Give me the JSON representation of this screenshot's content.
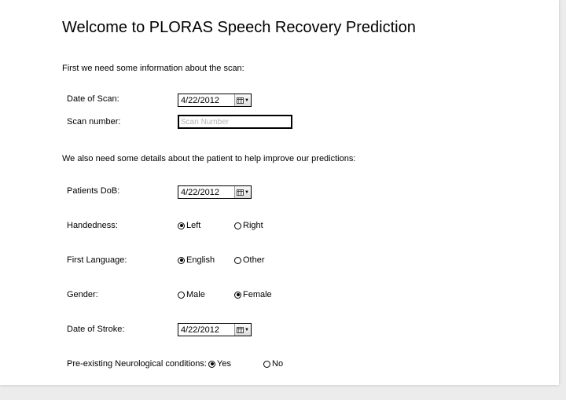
{
  "title": "Welcome to PLORAS Speech Recovery Prediction",
  "scan_section": {
    "intro": "First we need some information about the scan:",
    "date_label": "Date of Scan:",
    "date_value": "4/22/2012",
    "number_label": "Scan number:",
    "number_placeholder": "Scan Number",
    "number_value": ""
  },
  "patient_section": {
    "intro": "We also need some details about the patient to help improve our predictions:",
    "dob_label": "Patients DoB:",
    "dob_value": "4/22/2012",
    "handedness_label": "Handedness:",
    "handedness_options": [
      "Left",
      "Right"
    ],
    "handedness_selected": "Left",
    "language_label": "First Language:",
    "language_options": [
      "English",
      "Other"
    ],
    "language_selected": "English",
    "gender_label": "Gender:",
    "gender_options": [
      "Male",
      "Female"
    ],
    "gender_selected": "Female",
    "stroke_label": "Date of Stroke:",
    "stroke_value": "4/22/2012",
    "conditions_label": "Pre-existing Neurological conditions:",
    "conditions_options": [
      "Yes",
      "No"
    ],
    "conditions_selected": "Yes"
  },
  "icons": {
    "date_picker": "calendar-icon",
    "dropdown": "chevron-down-icon"
  }
}
